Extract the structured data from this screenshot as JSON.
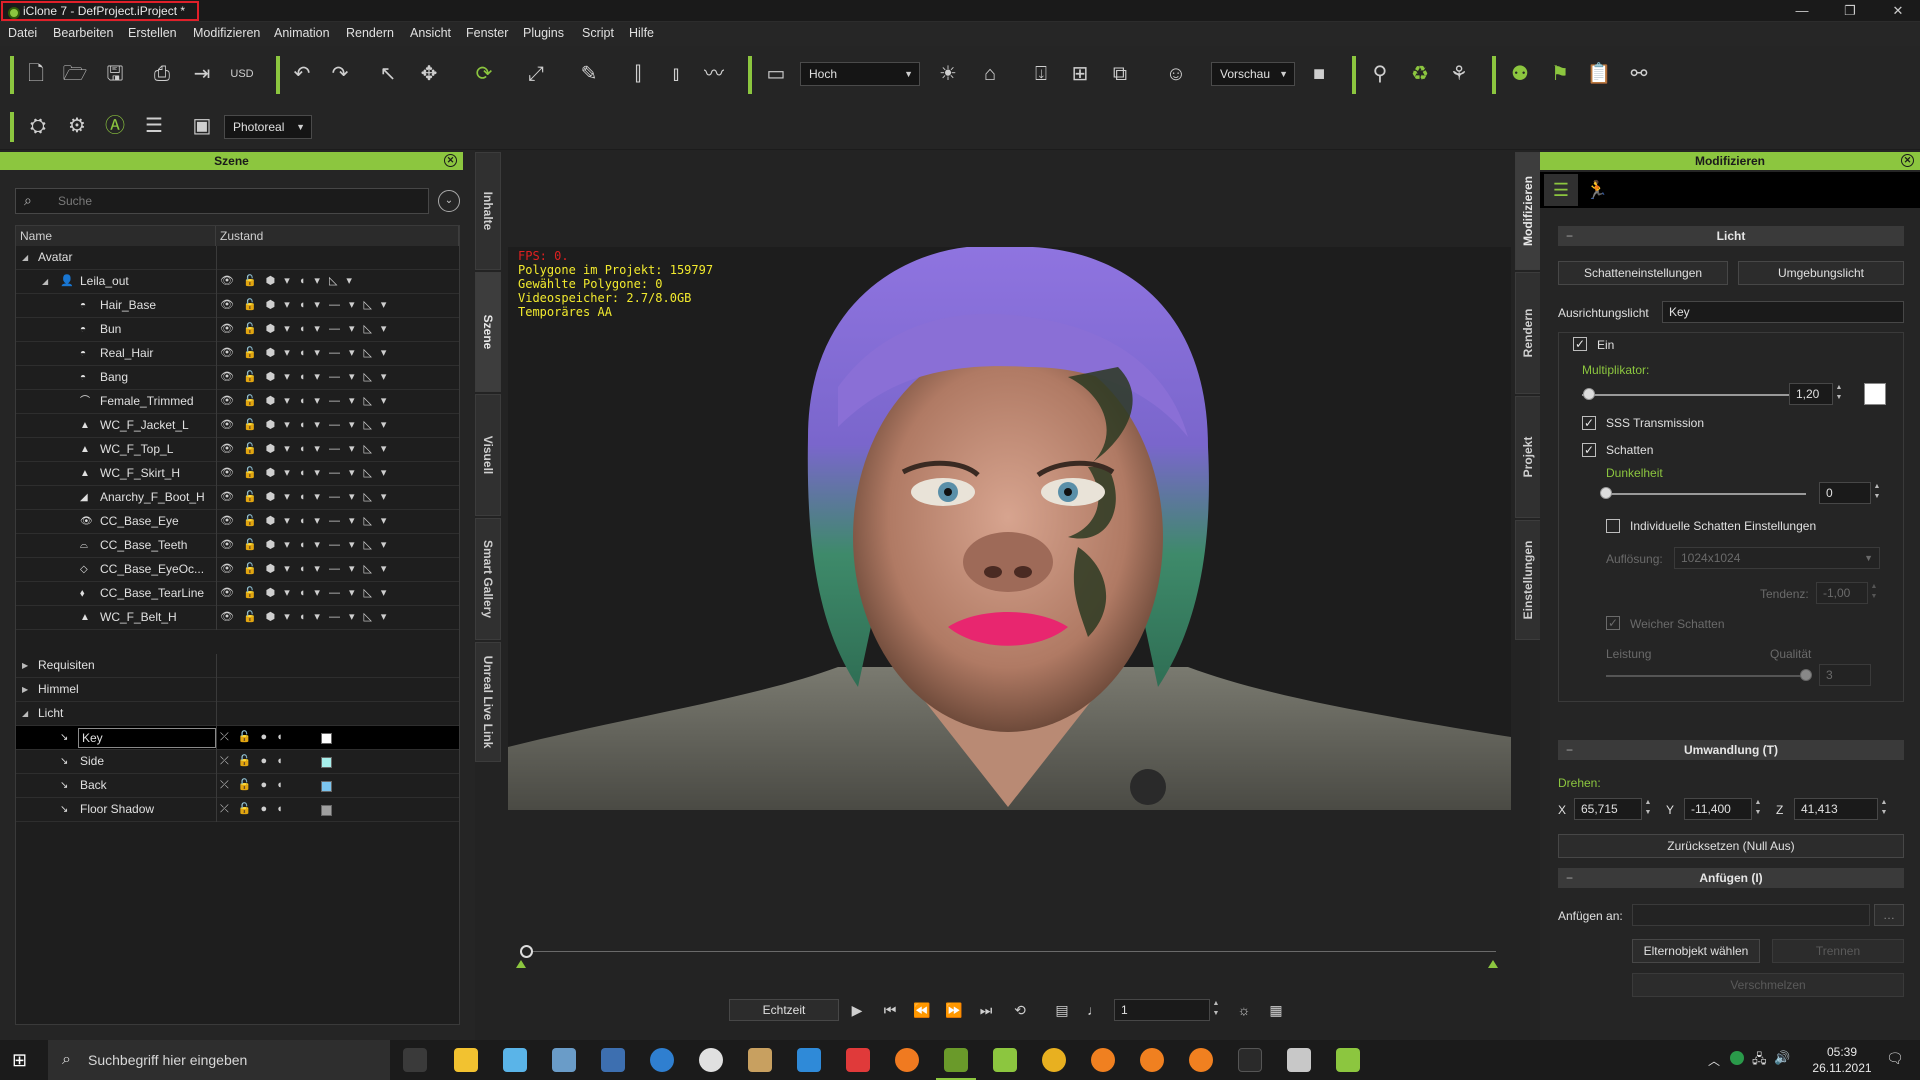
{
  "window": {
    "title": "iClone 7 - DefProject.iProject *"
  },
  "menu": [
    "Datei",
    "Bearbeiten",
    "Erstellen",
    "Modifizieren",
    "Animation",
    "Rendern",
    "Ansicht",
    "Fenster",
    "Plugins",
    "Script",
    "Hilfe"
  ],
  "toolbar": {
    "quality_dropdown": "Hoch",
    "preview_dropdown": "Vorschau",
    "render_mode_dropdown": "Photoreal"
  },
  "scene_panel": {
    "title": "Szene",
    "search_placeholder": "Suche",
    "columns": [
      "Name",
      "Zustand"
    ],
    "tree": {
      "avatar": "Avatar",
      "leila": "Leila_out",
      "children": [
        "Hair_Base",
        "Bun",
        "Real_Hair",
        "Bang",
        "Female_Trimmed",
        "WC_F_Jacket_L",
        "WC_F_Top_L",
        "WC_F_Skirt_H",
        "Anarchy_F_Boot_H",
        "CC_Base_Eye",
        "CC_Base_Teeth",
        "CC_Base_EyeOc...",
        "CC_Base_TearLine",
        "WC_F_Belt_H"
      ],
      "props": "Requisiten",
      "sky": "Himmel",
      "light": "Licht",
      "lights": [
        {
          "name": "Key",
          "swatch": "#ffffff"
        },
        {
          "name": "Side",
          "swatch": "#a8f0ec"
        },
        {
          "name": "Back",
          "swatch": "#7cc4ee"
        },
        {
          "name": "Floor Shadow",
          "swatch": "#a0a0a0"
        }
      ]
    }
  },
  "side_tabs_left": [
    "Inhalte",
    "Szene",
    "Visuell",
    "Smart Gallery",
    "Unreal Live Link"
  ],
  "side_tabs_right": [
    "Modifizieren",
    "Rendern",
    "Projekt",
    "Einstellungen"
  ],
  "viewport": {
    "fps": "FPS: 0.",
    "stats": [
      "Polygone im Projekt: 159797",
      "Gewählte Polygone: 0",
      "Videospeicher: 2.7/8.0GB",
      "Temporäres AA"
    ]
  },
  "playback": {
    "mode_button": "Echtzeit",
    "frame": "1"
  },
  "modify_panel": {
    "title": "Modifizieren",
    "light_section": "Licht",
    "shadow_settings_btn": "Schatteneinstellungen",
    "ambient_btn": "Umgebungslicht",
    "direction_light_label": "Ausrichtungslicht",
    "direction_light_value": "Key",
    "on_label": "Ein",
    "multiplier_label": "Multiplikator:",
    "multiplier_value": "1,20",
    "multiplier_fraction": 0.03,
    "sss_label": "SSS Transmission",
    "shadow_label": "Schatten",
    "darkness_label": "Dunkelheit",
    "darkness_value": "0",
    "darkness_fraction": 0.0,
    "individual_shadow_label": "Individuelle Schatten Einstellungen",
    "resolution_label": "Auflösung:",
    "resolution_value": "1024x1024",
    "bias_label": "Tendenz:",
    "bias_value": "-1,00",
    "soft_shadow_label": "Weicher Schatten",
    "performance_label": "Leistung",
    "quality_label": "Qualität",
    "quality_value": "3",
    "quality_fraction": 1.0,
    "transform_section": "Umwandlung (T)",
    "rotate_label": "Drehen:",
    "rot_x_label": "X",
    "rot_x": "65,715",
    "rot_y_label": "Y",
    "rot_y": "-11,400",
    "rot_z_label": "Z",
    "rot_z": "41,413",
    "reset_btn": "Zurücksetzen (Null Aus)",
    "attach_section": "Anfügen (I)",
    "attach_to_label": "Anfügen an:",
    "pick_parent_btn": "Elternobjekt wählen",
    "detach_btn": "Trennen",
    "merge_btn": "Verschmelzen",
    "section_collapse": "−"
  },
  "taskbar": {
    "search_placeholder": "Suchbegriff hier eingeben",
    "time": "05:39",
    "date": "26.11.2021"
  },
  "colors": {
    "accent": "#8cc63f",
    "title_highlight": "#e0202a",
    "hair": "#8a6fd6",
    "lips": "#e8266f"
  }
}
